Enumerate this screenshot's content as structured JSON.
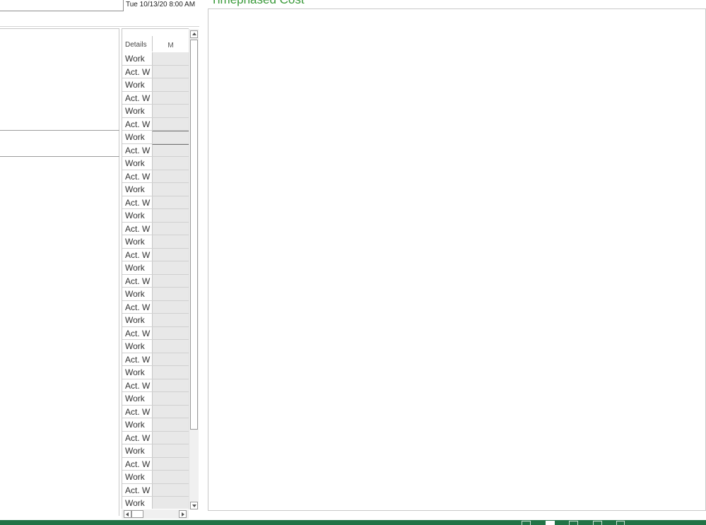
{
  "header": {
    "date_value": "Tue 10/13/20 8:00 AM"
  },
  "chart_panel": {
    "title": "Timephased Cost"
  },
  "grid": {
    "details_header": "Details",
    "column_header": "M",
    "rows": [
      "Work",
      "Act. W",
      "Work",
      "Act. W",
      "Work",
      "Act. W",
      "Work",
      "Act. W",
      "Work",
      "Act. W",
      "Work",
      "Act. W",
      "Work",
      "Act. W",
      "Work",
      "Act. W",
      "Work",
      "Act. W",
      "Work",
      "Act. W",
      "Work",
      "Act. W",
      "Work",
      "Act. W",
      "Work",
      "Act. W",
      "Work",
      "Act. W",
      "Work",
      "Act. W",
      "Work",
      "Act. W",
      "Work",
      "Act. W",
      "Work"
    ]
  },
  "colors": {
    "accent_green": "#217346",
    "title_green": "#3a9a3a"
  }
}
